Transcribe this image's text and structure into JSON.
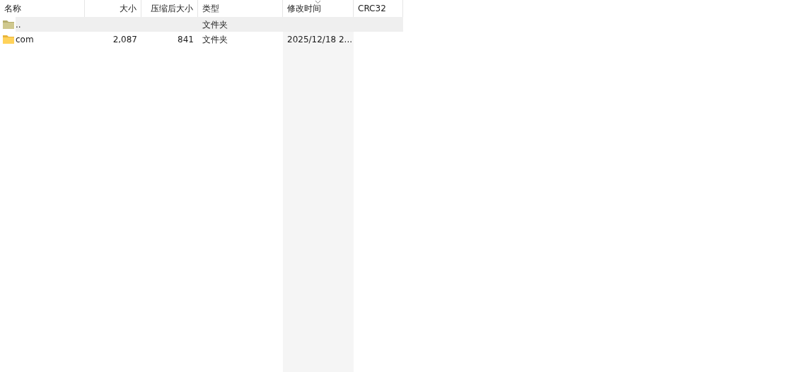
{
  "columns": [
    {
      "label": "名称",
      "sorted": false
    },
    {
      "label": "大小",
      "sorted": false
    },
    {
      "label": "压缩后大小",
      "sorted": false
    },
    {
      "label": "类型",
      "sorted": false
    },
    {
      "label": "修改时间",
      "sorted": true
    },
    {
      "label": "CRC32",
      "sorted": false
    }
  ],
  "rows": [
    {
      "kind": "parent",
      "selected": true,
      "cells": [
        "..",
        "",
        "",
        "文件夹",
        "",
        ""
      ]
    },
    {
      "kind": "folder",
      "selected": false,
      "cells": [
        "com",
        "2,087",
        "841",
        "文件夹",
        "2025/12/18 2...",
        ""
      ]
    }
  ]
}
